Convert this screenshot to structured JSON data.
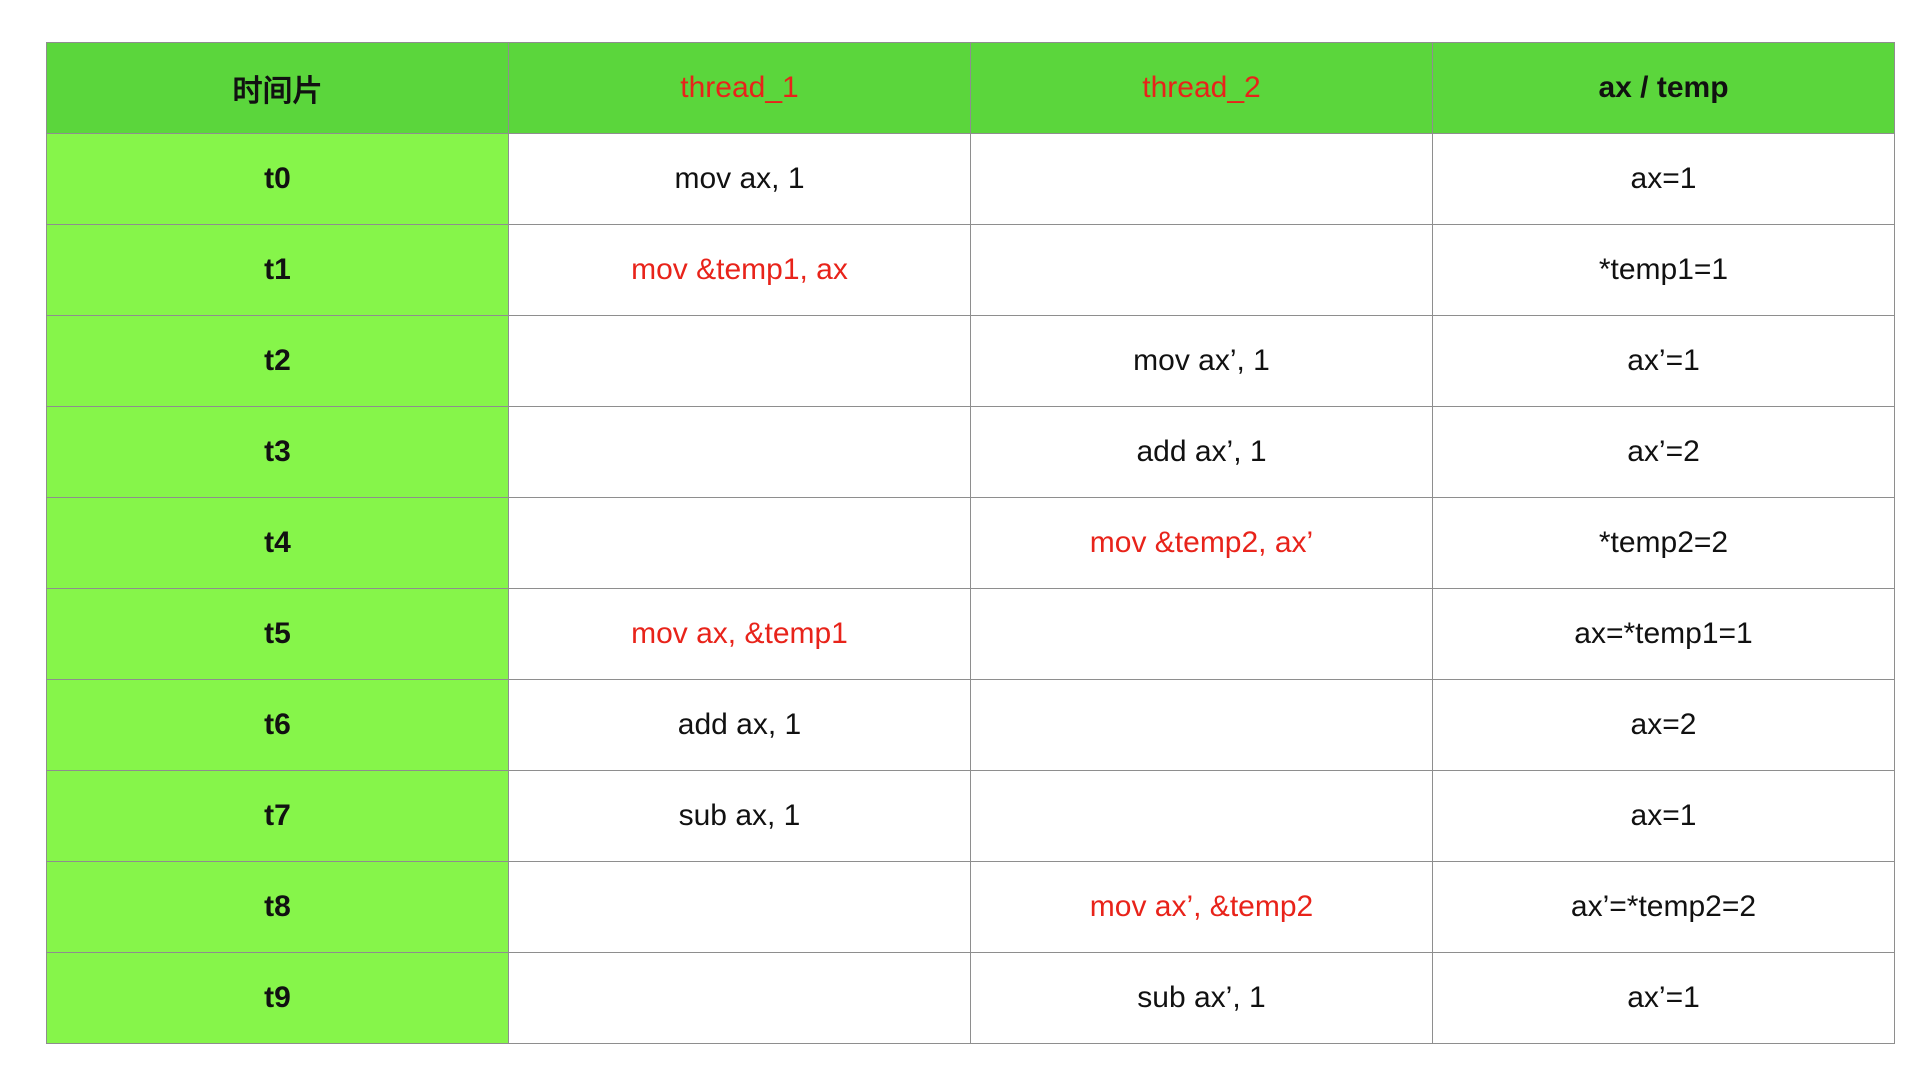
{
  "colors": {
    "header_bg": "#5bd63c",
    "time_col_bg": "#86f54a",
    "highlight_text": "#e8231a",
    "text": "#111111",
    "border": "#8e8e8e"
  },
  "table": {
    "headers": [
      "时间片",
      "thread_1",
      "thread_2",
      "ax / temp"
    ],
    "header_highlight": [
      false,
      true,
      true,
      false
    ],
    "rows": [
      {
        "time": "t0",
        "thread_1": "mov ax, 1",
        "thread_2": "",
        "state": "ax=1",
        "highlight": "none"
      },
      {
        "time": "t1",
        "thread_1": "mov &temp1, ax",
        "thread_2": "",
        "state": "*temp1=1",
        "highlight": "thread_1"
      },
      {
        "time": "t2",
        "thread_1": "",
        "thread_2": "mov ax’, 1",
        "state": "ax’=1",
        "highlight": "none"
      },
      {
        "time": "t3",
        "thread_1": "",
        "thread_2": "add ax’, 1",
        "state": "ax’=2",
        "highlight": "none"
      },
      {
        "time": "t4",
        "thread_1": "",
        "thread_2": "mov &temp2, ax’",
        "state": "*temp2=2",
        "highlight": "thread_2"
      },
      {
        "time": "t5",
        "thread_1": "mov ax, &temp1",
        "thread_2": "",
        "state": "ax=*temp1=1",
        "highlight": "thread_1"
      },
      {
        "time": "t6",
        "thread_1": "add ax, 1",
        "thread_2": "",
        "state": "ax=2",
        "highlight": "none"
      },
      {
        "time": "t7",
        "thread_1": "sub ax, 1",
        "thread_2": "",
        "state": "ax=1",
        "highlight": "none"
      },
      {
        "time": "t8",
        "thread_1": "",
        "thread_2": "mov ax’, &temp2",
        "state": "ax’=*temp2=2",
        "highlight": "thread_2"
      },
      {
        "time": "t9",
        "thread_1": "",
        "thread_2": "sub ax’, 1",
        "state": "ax’=1",
        "highlight": "none"
      }
    ]
  }
}
